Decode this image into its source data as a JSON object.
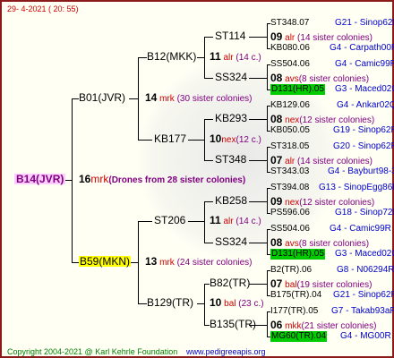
{
  "header": {
    "date": "29-  4-2021  ( 20: 55)"
  },
  "footer": {
    "copyright": "Copyright 2004-2021 @ Karl Kehrle Foundation",
    "website": "www.pedigreeapis.org"
  },
  "colors": {
    "frame": "#8b1a1a",
    "highlight_green": "#00cc00",
    "highlight_yellow": "#ffff00",
    "root_bg": "#ffccff",
    "origin": "#0000cc",
    "mark": "#cc0000",
    "sisters": "#800080"
  },
  "root": {
    "name": "B14(JVR)",
    "year": "16",
    "mark": "mrk",
    "drones": "(Drones from 28 sister colonies)"
  },
  "g1": [
    {
      "name": "B01(JVR)",
      "year": "14",
      "mark": "mrk",
      "sisters": "(30 sister colonies)"
    },
    {
      "name": "B59(MKN)",
      "year": "13",
      "mark": "mrk",
      "sisters": "(24 sister colonies)"
    }
  ],
  "g2": [
    {
      "name": "B12(MKK)",
      "year": "11",
      "mark": "alr",
      "sisters": "(14 c.)"
    },
    {
      "name": "KB177",
      "year": "10",
      "mark": "nex",
      "sisters": "(12 c.)"
    },
    {
      "name": "ST206",
      "year": "11",
      "mark": "alr",
      "sisters": "(14 c.)"
    },
    {
      "name": "B129(TR)",
      "year": "10",
      "mark": "bal",
      "sisters": "(23 c.)"
    }
  ],
  "g3": [
    {
      "name": "ST114"
    },
    {
      "name": "SS324"
    },
    {
      "name": "KB293"
    },
    {
      "name": "ST348"
    },
    {
      "name": "KB258"
    },
    {
      "name": "SS324"
    },
    {
      "name": "B82(TR)"
    },
    {
      "name": "B135(TR)"
    }
  ],
  "g4": [
    {
      "top": "ST348.07",
      "top_loc": "G21 - Sinop62R",
      "year": "09",
      "mark": "alr",
      "sisters": "(14 sister colonies)",
      "bot": "KB080.06",
      "bot_loc": "G4 - Carpath00R"
    },
    {
      "top": "SS504.06",
      "top_loc": "G4 - Camic99R",
      "year": "08",
      "mark": "avs",
      "sisters": "(8 sister colonies)",
      "bot": "D131(HR).05",
      "bot_loc": "G3 - Maced02Q"
    },
    {
      "top": "KB129.06",
      "top_loc": "G4 - Ankar02Q",
      "year": "08",
      "mark": "nex",
      "sisters": "(12 sister colonies)",
      "bot": "KB050.05",
      "bot_loc": "G19 - Sinop62R"
    },
    {
      "top": "ST318.05",
      "top_loc": "G20 - Sinop62R",
      "year": "07",
      "mark": "alr",
      "sisters": "(14 sister colonies)",
      "bot": "ST343.03",
      "bot_loc": "G4 - Bayburt98-3"
    },
    {
      "top": "ST394.08",
      "top_loc": "G13 - SinopEgg86R",
      "year": "09",
      "mark": "nex",
      "sisters": "(12 sister colonies)",
      "bot": "PS596.06",
      "bot_loc": "G18 - Sinop72R"
    },
    {
      "top": "SS504.06",
      "top_loc": "G4 - Camic99R",
      "year": "08",
      "mark": "avs",
      "sisters": "(8 sister colonies)",
      "bot": "D131(HR).05",
      "bot_loc": "G3 - Maced02Q"
    },
    {
      "top": "B2(TR).06",
      "top_loc": "G8 - N06294R",
      "year": "07",
      "mark": "bal",
      "sisters": "(19 sister colonies)",
      "bot": "B175(TR).04",
      "bot_loc": "G21 - Sinop62R"
    },
    {
      "top": "I177(TR).05",
      "top_loc": "G7 - Takab93aR",
      "year": "06",
      "mark": "mkk",
      "sisters": "(21 sister colonies)",
      "bot": "MG60(TR).04",
      "bot_loc": "G4 - MG00R"
    }
  ]
}
